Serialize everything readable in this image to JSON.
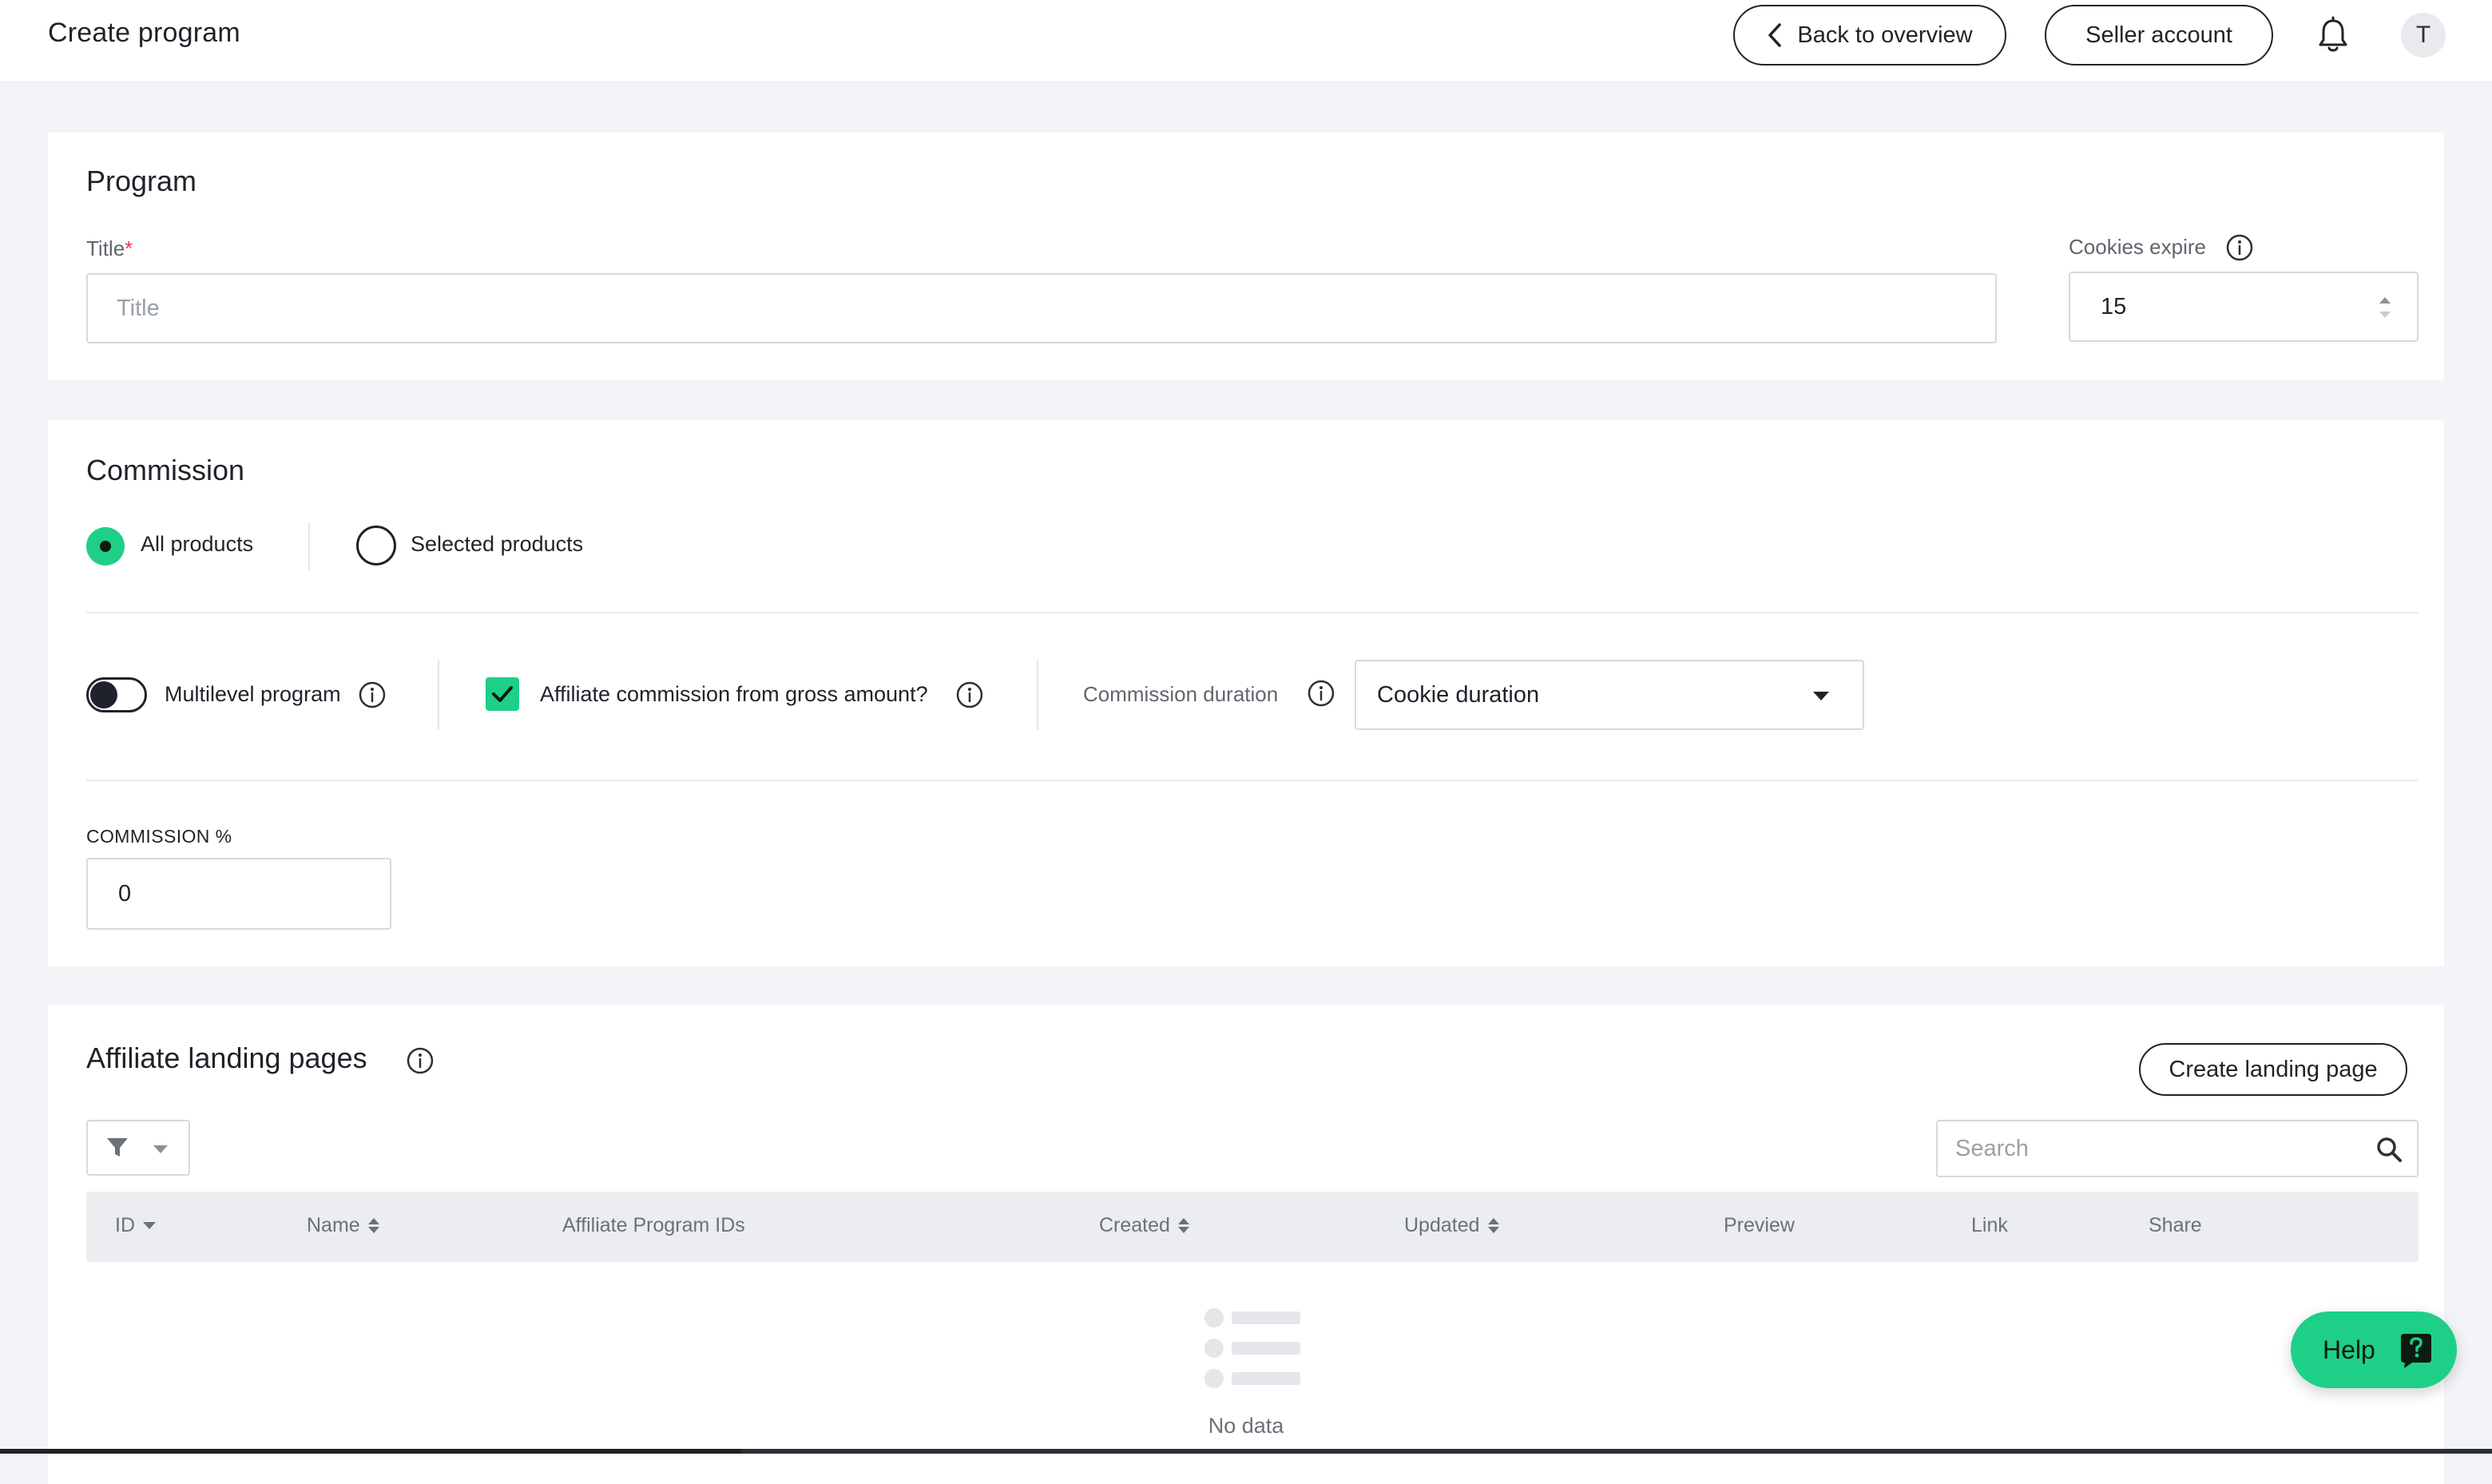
{
  "header": {
    "title": "Create program",
    "back_label": "Back to overview",
    "seller_label": "Seller account",
    "avatar_initial": "T"
  },
  "program": {
    "heading": "Program",
    "title_label": "Title",
    "title_required_mark": "*",
    "title_placeholder": "Title",
    "title_value": "",
    "cookies_label": "Cookies expire",
    "cookies_value": "15"
  },
  "commission": {
    "heading": "Commission",
    "scope_options": [
      "All products",
      "Selected products"
    ],
    "scope_selected": "All products",
    "multilevel_label": "Multilevel program",
    "multilevel_on": false,
    "gross_label": "Affiliate commission from gross amount?",
    "gross_checked": true,
    "duration_label": "Commission duration",
    "duration_value": "Cookie duration",
    "percent_label": "COMMISSION %",
    "percent_value": "0"
  },
  "landing": {
    "heading": "Affiliate landing pages",
    "create_label": "Create landing page",
    "search_placeholder": "Search",
    "columns": [
      "ID",
      "Name",
      "Affiliate Program IDs",
      "Created",
      "Updated",
      "Preview",
      "Link",
      "Share"
    ],
    "empty_text": "No data"
  },
  "help": {
    "label": "Help"
  },
  "colors": {
    "accent": "#1ecf88",
    "text": "#1f2329",
    "background": "#f3f4f7"
  }
}
